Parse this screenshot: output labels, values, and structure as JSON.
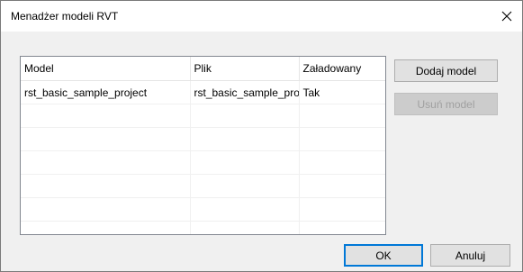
{
  "window": {
    "title": "Menadżer modeli RVT"
  },
  "table": {
    "columns": [
      "Model",
      "Plik",
      "Załadowany"
    ],
    "rows": [
      [
        "rst_basic_sample_project",
        "rst_basic_sample_project.rvt",
        "Tak"
      ]
    ]
  },
  "buttons": {
    "add": "Dodaj model",
    "remove": "Usuń model",
    "ok": "OK",
    "cancel": "Anuluj"
  },
  "colors": {
    "accent": "#0078d7",
    "disabled_text": "#a0a0a0"
  },
  "icons": {
    "close": "close-icon"
  }
}
